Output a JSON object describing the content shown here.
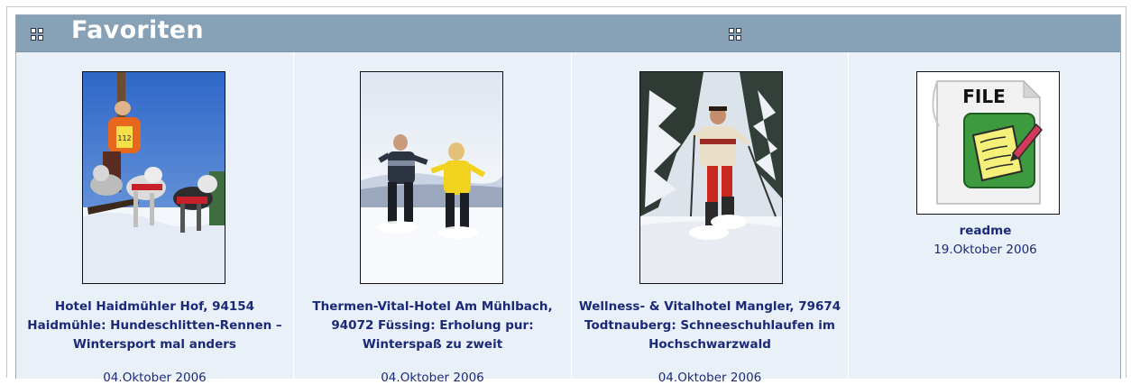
{
  "panel": {
    "title": "Favoriten"
  },
  "items": [
    {
      "caption": "Hotel Haidmühler Hof, 94154 Haidmühle: Hundeschlitten-Rennen – Wintersport mal anders",
      "date": "04.Oktober 2006",
      "image": "dog-sled-race-photo",
      "bib_number": "112"
    },
    {
      "caption": "Thermen-Vital-Hotel Am Mühlbach, 94072 Füssing: Erholung pur: Winterspaß zu zweit",
      "date": "04.Oktober 2006",
      "image": "couple-running-in-snow-photo"
    },
    {
      "caption": "Wellness- & Vitalhotel Mangler, 79674 Todtnauberg: Schneeschuhlaufen im Hochschwarzwald",
      "date": "04.Oktober 2006",
      "image": "snowshoe-hiker-photo"
    },
    {
      "caption": "readme",
      "date": "19.Oktober 2006",
      "image": "file-icon",
      "icon_label": "FILE"
    }
  ],
  "icons": {
    "collapse": "grid-icon",
    "layout": "grid-icon"
  },
  "colors": {
    "titlebar": "#87a1b7",
    "panel_bg": "#eaf0f7",
    "link": "#1a2a78"
  }
}
